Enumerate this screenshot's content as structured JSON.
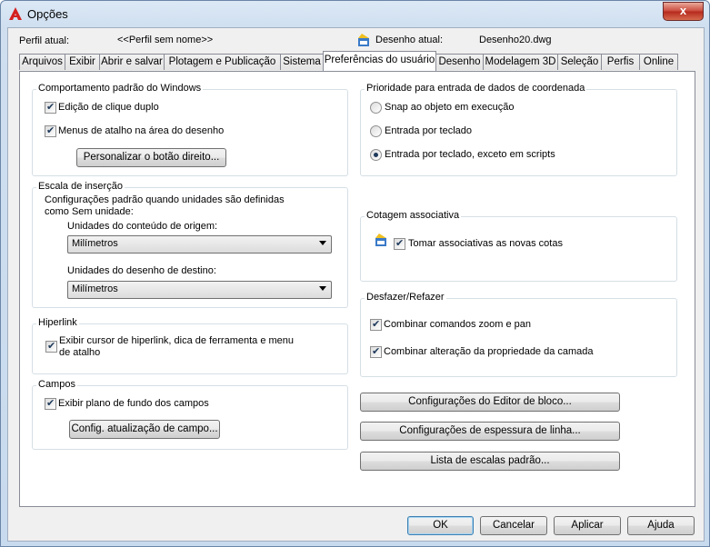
{
  "window": {
    "title": "Opções",
    "close_label": "x"
  },
  "profile": {
    "label": "Perfil atual:",
    "value": "<<Perfil sem nome>>",
    "drawing_label": "Desenho atual:",
    "drawing_value": "Desenho20.dwg"
  },
  "tabs": [
    {
      "label": "Arquivos"
    },
    {
      "label": "Exibir"
    },
    {
      "label": "Abrir e salvar"
    },
    {
      "label": "Plotagem e Publicação"
    },
    {
      "label": "Sistema"
    },
    {
      "label": "Preferências do usuário"
    },
    {
      "label": "Desenho"
    },
    {
      "label": "Modelagem 3D"
    },
    {
      "label": "Seleção"
    },
    {
      "label": "Perfis"
    },
    {
      "label": "Online"
    }
  ],
  "windows_behavior": {
    "title": "Comportamento padrão do Windows",
    "double_click": "Edição de clique duplo",
    "shortcut_menus": "Menus de atalho na área do desenho",
    "right_click_button": "Personalizar o botão direito..."
  },
  "insertion_scale": {
    "title": "Escala de inserção",
    "description_line1": "Configurações padrão quando unidades são definidas",
    "description_line2": "como Sem unidade:",
    "source_label": "Unidades do conteúdo de origem:",
    "source_value": "Milímetros",
    "target_label": "Unidades do desenho de destino:",
    "target_value": "Milímetros"
  },
  "hyperlink": {
    "title": "Hiperlink",
    "option_line1": "Exibir cursor de hiperlink, dica de ferramenta e menu",
    "option_line2": "de atalho"
  },
  "fields": {
    "title": "Campos",
    "background": "Exibir plano de fundo dos campos",
    "update_button": "Config. atualização de campo..."
  },
  "coordinate_priority": {
    "title": "Prioridade para entrada de dados de coordenada",
    "option1": "Snap ao objeto em execução",
    "option2": "Entrada por teclado",
    "option3": "Entrada por teclado, exceto em scripts",
    "selected": "option3"
  },
  "associative_dim": {
    "title": "Cotagem associativa",
    "option": "Tomar associativas as novas cotas"
  },
  "undo_redo": {
    "title": "Desfazer/Refazer",
    "zoom_pan": "Combinar comandos zoom e pan",
    "layer_property": "Combinar alteração da propriedade da camada"
  },
  "right_buttons": {
    "block_editor": "Configurações do Editor de bloco...",
    "lineweight": "Configurações de espessura de linha...",
    "scale_list": "Lista de escalas padrão..."
  },
  "footer": {
    "ok": "OK",
    "cancel": "Cancelar",
    "apply": "Aplicar",
    "help": "Ajuda"
  }
}
